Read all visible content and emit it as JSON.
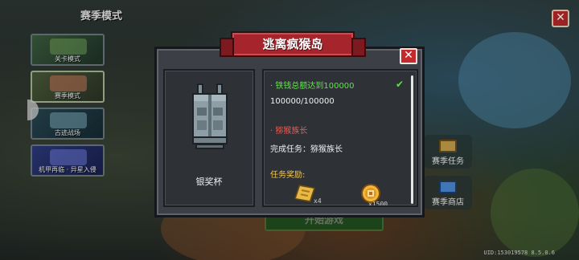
{
  "screen": {
    "title": "赛季模式",
    "uid_text": "UID:153019578 8.5.0.6"
  },
  "modes": [
    {
      "label": "关卡模式"
    },
    {
      "label": "赛季模式"
    },
    {
      "label": "古迹战场"
    },
    {
      "label": "机甲再临 · 异星入侵"
    }
  ],
  "right_buttons": [
    {
      "label": "赛季任务",
      "icon": "scroll-icon"
    },
    {
      "label": "赛季商店",
      "icon": "cart-icon"
    }
  ],
  "start_button": {
    "label": "开始游戏"
  },
  "dialog": {
    "title": "逃离疯猴岛",
    "reward_name": "银奖杯",
    "task1": {
      "title": "· 铁钱总额达到100000",
      "progress": "100000/100000",
      "completed": true
    },
    "task2": {
      "title": "· 猕猴族长",
      "desc": "完成任务：猕猴族长",
      "completed": false
    },
    "rewards_label": "任务奖励:",
    "rewards": [
      {
        "icon": "gold-ticket-icon",
        "count": "x4"
      },
      {
        "icon": "coin-icon",
        "count": "x1500"
      }
    ]
  },
  "colors": {
    "banner": "#a6242b",
    "done": "#63e24e",
    "pending": "#f15a4e",
    "reward_label": "#f3c84a"
  }
}
